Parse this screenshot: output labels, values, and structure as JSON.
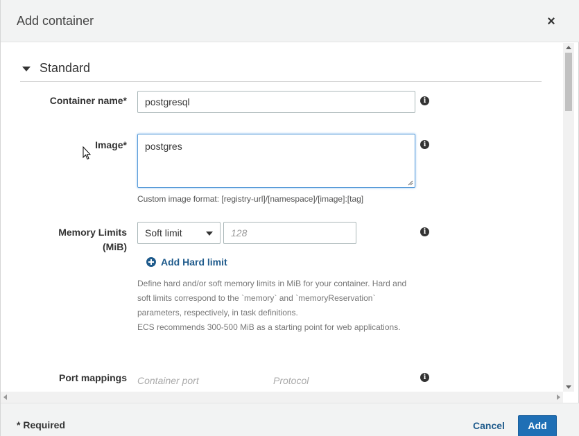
{
  "modal": {
    "title": "Add container",
    "close_symbol": "×"
  },
  "section": {
    "title": "Standard"
  },
  "fields": {
    "container_name": {
      "label": "Container name*",
      "value": "postgresql"
    },
    "image": {
      "label": "Image*",
      "value": "postgres",
      "hint": "Custom image format: [registry-url]/[namespace]/[image]:[tag]"
    },
    "memory_limits": {
      "label_line1": "Memory Limits",
      "label_line2": "(MiB)",
      "select_value": "Soft limit",
      "input_placeholder": "128",
      "add_hard_limit": "Add Hard limit",
      "description": [
        "Define hard and/or soft memory limits in MiB for your container. Hard and",
        "soft limits correspond to the `memory` and `memoryReservation`",
        "parameters, respectively, in task definitions.",
        "ECS recommends 300-500 MiB as a starting point for web applications."
      ]
    },
    "port_mappings": {
      "label": "Port mappings",
      "container_port_placeholder": "Container port",
      "protocol_placeholder": "Protocol"
    }
  },
  "footer": {
    "required_note": "* Required",
    "cancel_label": "Cancel",
    "add_label": "Add"
  },
  "icons": {
    "info": "info-icon",
    "plus": "plus-circle-icon",
    "caret": "caret-down-icon",
    "close": "close-icon"
  },
  "colors": {
    "link": "#1f5b8c",
    "primary_button": "#1f6fb5",
    "focus_border": "#5b9dd9",
    "header_bg": "#f2f3f3"
  }
}
